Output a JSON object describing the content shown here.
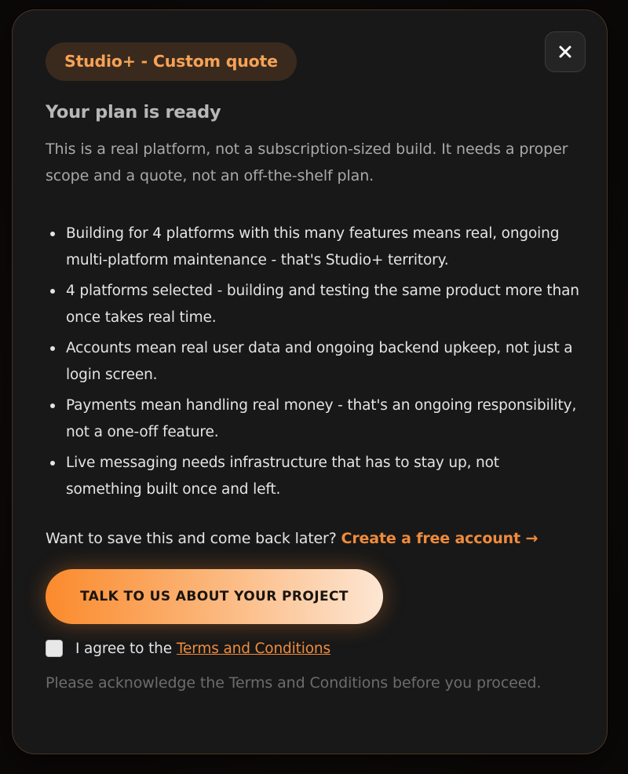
{
  "badge": {
    "label": "Studio+ - Custom quote"
  },
  "close": {
    "icon": "close-icon",
    "aria_label": "Close"
  },
  "header": {
    "title": "Your plan is ready",
    "description": "This is a real platform, not a subscription-sized build. It needs a proper scope and a quote, not an off-the-shelf plan."
  },
  "reasons": [
    "Building for 4 platforms with this many features means real, ongoing multi-platform maintenance - that's Studio+ territory.",
    "4 platforms selected - building and testing the same product more than once takes real time.",
    "Accounts mean real user data and ongoing backend upkeep, not just a login screen.",
    "Payments mean handling real money - that's an ongoing responsibility, not a one-off feature.",
    "Live messaging needs infrastructure that has to stay up, not something built once and left."
  ],
  "save": {
    "prompt": "Want to save this and come back later?",
    "link_label": "Create a free account →"
  },
  "cta": {
    "label": "TALK TO US ABOUT YOUR PROJECT"
  },
  "terms": {
    "checked": false,
    "prefix": "I agree to the",
    "link_label": "Terms and Conditions",
    "notice": "Please acknowledge the Terms and Conditions before you proceed."
  },
  "colors": {
    "accent": "#f08b3b",
    "badge_text": "#f5a257",
    "badge_bg": "#3a2a1d",
    "modal_bg": "#181818"
  }
}
